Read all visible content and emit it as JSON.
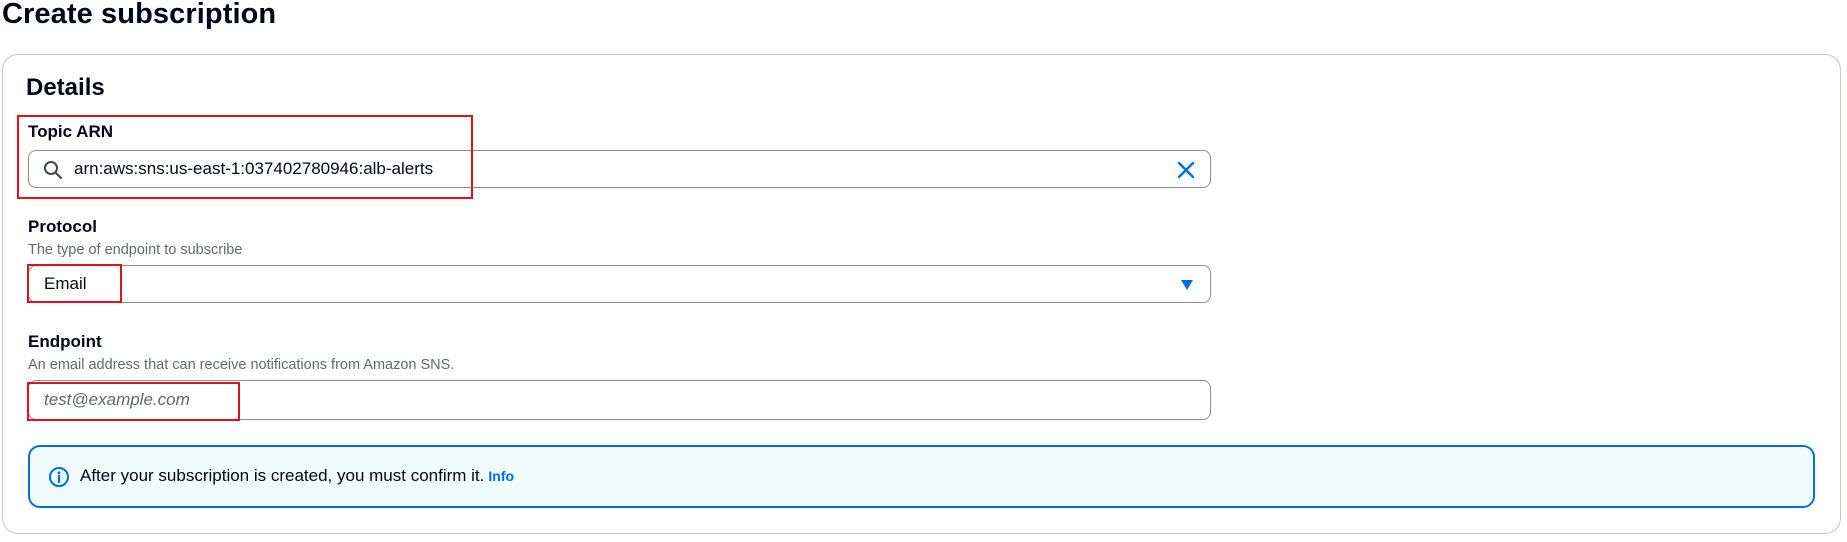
{
  "page": {
    "title": "Create subscription"
  },
  "details": {
    "title": "Details",
    "topic_arn": {
      "label": "Topic ARN",
      "value": "arn:aws:sns:us-east-1:037402780946:alb-alerts"
    },
    "protocol": {
      "label": "Protocol",
      "description": "The type of endpoint to subscribe",
      "selected": "Email"
    },
    "endpoint": {
      "label": "Endpoint",
      "description": "An email address that can receive notifications from Amazon SNS.",
      "placeholder": "test@example.com",
      "value": ""
    },
    "alert": {
      "text": "After your subscription is created, you must confirm it.",
      "link_label": "Info"
    }
  },
  "colors": {
    "accent": "#006ce0",
    "highlight": "#e0121c",
    "alert_background": "#f0fbff"
  },
  "icons": {
    "search": "search-icon",
    "clear": "close-icon",
    "dropdown": "caret-down-icon",
    "info": "info-circle-icon"
  }
}
